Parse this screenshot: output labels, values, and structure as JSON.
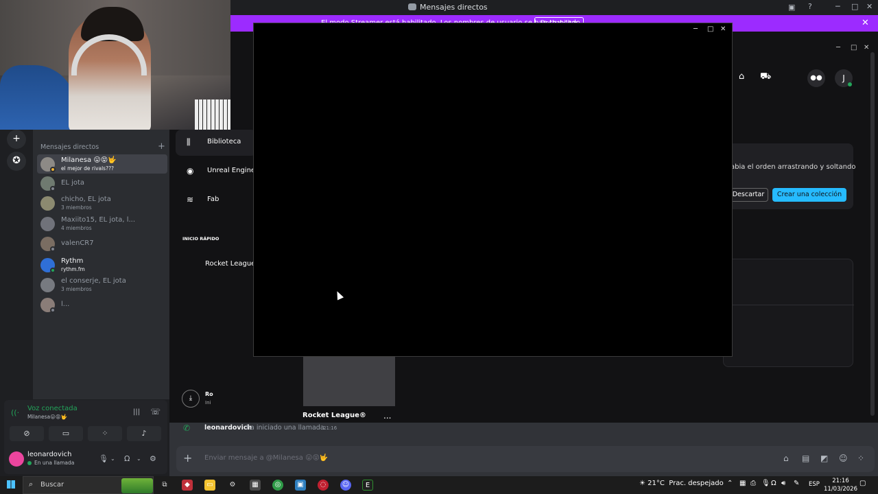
{
  "titlebar": {
    "title": "Mensajes directos"
  },
  "banner": {
    "text": "El modo Streamer está habilitado. Los nombres de usuario se han truncado.",
    "button": "Deshabilitar"
  },
  "dm_list": {
    "header": "Mensajes directos",
    "add": "+",
    "items": [
      {
        "name": "Milanesa 😛😝🤟",
        "sub": "el mejor de rivals???",
        "status": "idle",
        "active": true
      },
      {
        "name": "EL jota",
        "sub": "",
        "status": "offline"
      },
      {
        "name": "chicho, EL jota",
        "sub": "3 miembros",
        "status": "none"
      },
      {
        "name": "Maxiito15, EL jota, l...",
        "sub": "4 miembros",
        "status": "none"
      },
      {
        "name": "valenCR7",
        "sub": "",
        "status": "offline"
      },
      {
        "name": "Rythm",
        "sub": "rythm.fm",
        "status": "online",
        "bright": true
      },
      {
        "name": "el conserje, EL jota",
        "sub": "3 miembros",
        "status": "none"
      },
      {
        "name": "l...",
        "sub": "",
        "status": "offline"
      }
    ]
  },
  "voice": {
    "label": "Voz conectada",
    "channel": "Milanesa😛😝🤟"
  },
  "user": {
    "name": "leonardovich",
    "status": "En una llamada"
  },
  "epic": {
    "nav": [
      "Biblioteca",
      "Unreal Engine",
      "Fab"
    ],
    "quick_start": "INICIO RÁPIDO",
    "quick_game": "Rocket League",
    "download_title": "Ro",
    "download_sub": "Ini",
    "reorder_text": "abia el orden arrastrando y soltando",
    "discard": "Descartar",
    "create": "Crear una colección",
    "card_title": "Rocket League®",
    "card_more": "...",
    "avatar_letter": "J"
  },
  "chat": {
    "caller": "leonardovich",
    "call_text": "ha iniciado una llamada.",
    "call_time": "21:16",
    "placeholder": "Enviar mensaje a @Milanesa 😛😝🤟"
  },
  "taskbar": {
    "search": "Buscar",
    "temp": "21°C",
    "weather": "Prac. despejado",
    "lang": "ESP",
    "time": "21:16",
    "date": "11/03/2026"
  },
  "colors": {
    "banner": "#9c2bff",
    "online": "#23a55a",
    "epic_accent": "#26bbff",
    "discord_bg": "#313338"
  },
  "icons": [
    "discord-icon",
    "plus-icon",
    "compass-icon",
    "library-icon",
    "unreal-icon",
    "fab-icon",
    "download-icon",
    "gift-icon",
    "cart-icon",
    "friends-icon",
    "phone-icon",
    "mic-icon",
    "headphones-icon",
    "gear-icon",
    "search-icon",
    "windows-icon"
  ]
}
